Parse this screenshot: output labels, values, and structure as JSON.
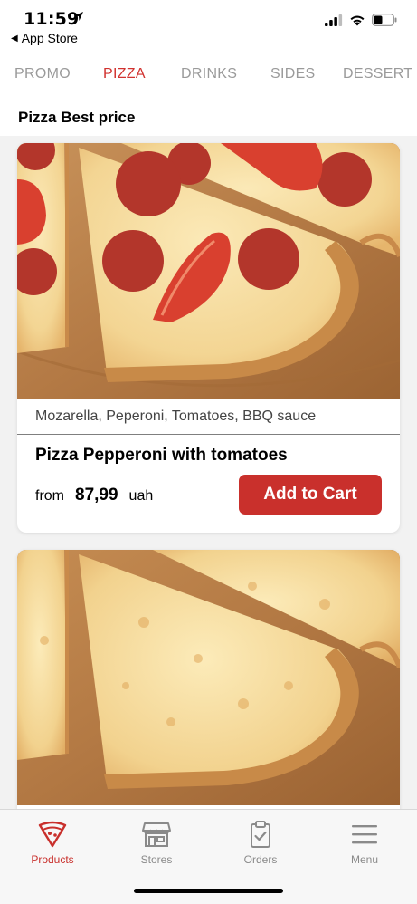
{
  "status_bar": {
    "time": "11:59",
    "back_label": "App Store"
  },
  "tabs": [
    {
      "label": "PROMO",
      "active": false
    },
    {
      "label": "PIZZA",
      "active": true
    },
    {
      "label": "DRINKS",
      "active": false
    },
    {
      "label": "SIDES",
      "active": false
    },
    {
      "label": "DESSERT",
      "active": false
    }
  ],
  "section": {
    "title": "Pizza Best price"
  },
  "products": [
    {
      "image_icon": "pepperoni-tomato-pizza",
      "description": "Mozarella, Peperoni, Tomatoes, BBQ sauce",
      "name": "Pizza Pepperoni with tomatoes",
      "price_prefix": "from",
      "price": "87,99",
      "currency": "uah",
      "button_label": "Add to Cart"
    },
    {
      "image_icon": "cheese-pizza"
    }
  ],
  "bottom_nav": [
    {
      "label": "Products",
      "icon": "pizza-slice-icon",
      "active": true
    },
    {
      "label": "Stores",
      "icon": "store-icon",
      "active": false
    },
    {
      "label": "Orders",
      "icon": "clipboard-icon",
      "active": false
    },
    {
      "label": "Menu",
      "icon": "hamburger-icon",
      "active": false
    }
  ],
  "colors": {
    "accent": "#c9302c",
    "tab_inactive": "#9a9a9a",
    "background": "#f2f2f2"
  }
}
